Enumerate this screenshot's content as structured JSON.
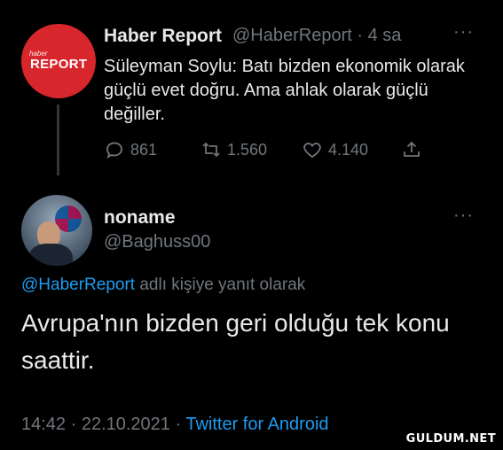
{
  "tweet1": {
    "avatar_small_text": "haber",
    "avatar_big_text": "REPORT",
    "display_name": "Haber Report",
    "handle_time": "@HaberReport · 4 sa",
    "more": "···",
    "text": "Süleyman Soylu: Batı bizden ekonomik olarak güçlü evet doğru. Ama ahlak olarak güçlü değiller.",
    "replies": "861",
    "retweets": "1.560",
    "likes": "4.140"
  },
  "tweet2": {
    "display_name": "noname",
    "handle": "@Baghuss00",
    "more": "···",
    "reply_handle": "@HaberReport",
    "reply_suffix": " adlı kişiye yanıt olarak",
    "text": "Avrupa'nın bizden geri olduğu tek konu saattir.",
    "time_date": "14:42 · 22.10.2021 · ",
    "source": "Twitter for Android"
  },
  "watermark": "GULDUM.NET",
  "colors": {
    "background": "#000000",
    "text": "#e7e9ea",
    "muted": "#71767b",
    "link": "#1d9bf0",
    "avatar_red": "#d7262c"
  }
}
